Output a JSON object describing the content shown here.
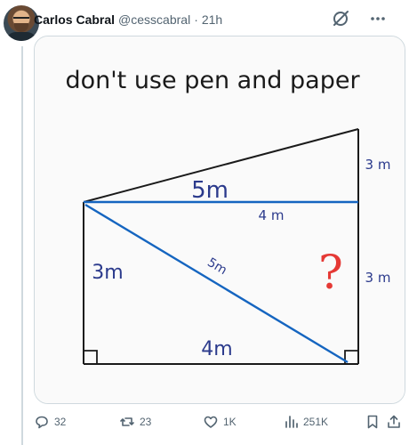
{
  "tweet": {
    "author_name": "Carlos Cabral",
    "handle": "@cesscabral",
    "separator": "·",
    "time": "21h"
  },
  "image": {
    "title": "don't use pen and paper",
    "labels": {
      "top_diagonal": "5m",
      "right_upper": "3 m",
      "mid_horizontal": "4 m",
      "question": "?",
      "left_side": "3m",
      "diagonal": "5m",
      "right_lower": "3 m",
      "bottom": "4m"
    }
  },
  "actions": {
    "replies": "32",
    "reposts": "23",
    "likes": "1K",
    "views": "251K"
  },
  "icons": {
    "reply": "reply-icon",
    "repost": "repost-icon",
    "like": "heart-icon",
    "views": "views-icon",
    "bookmark": "bookmark-icon",
    "share": "share-icon",
    "grok": "grok-icon",
    "more": "more-icon"
  },
  "colors": {
    "ink": "#1a1a1a",
    "blue_line": "#1565c0",
    "label_blue": "#2b3a8c",
    "question_red": "#e53935",
    "secondary_text": "#536471"
  }
}
